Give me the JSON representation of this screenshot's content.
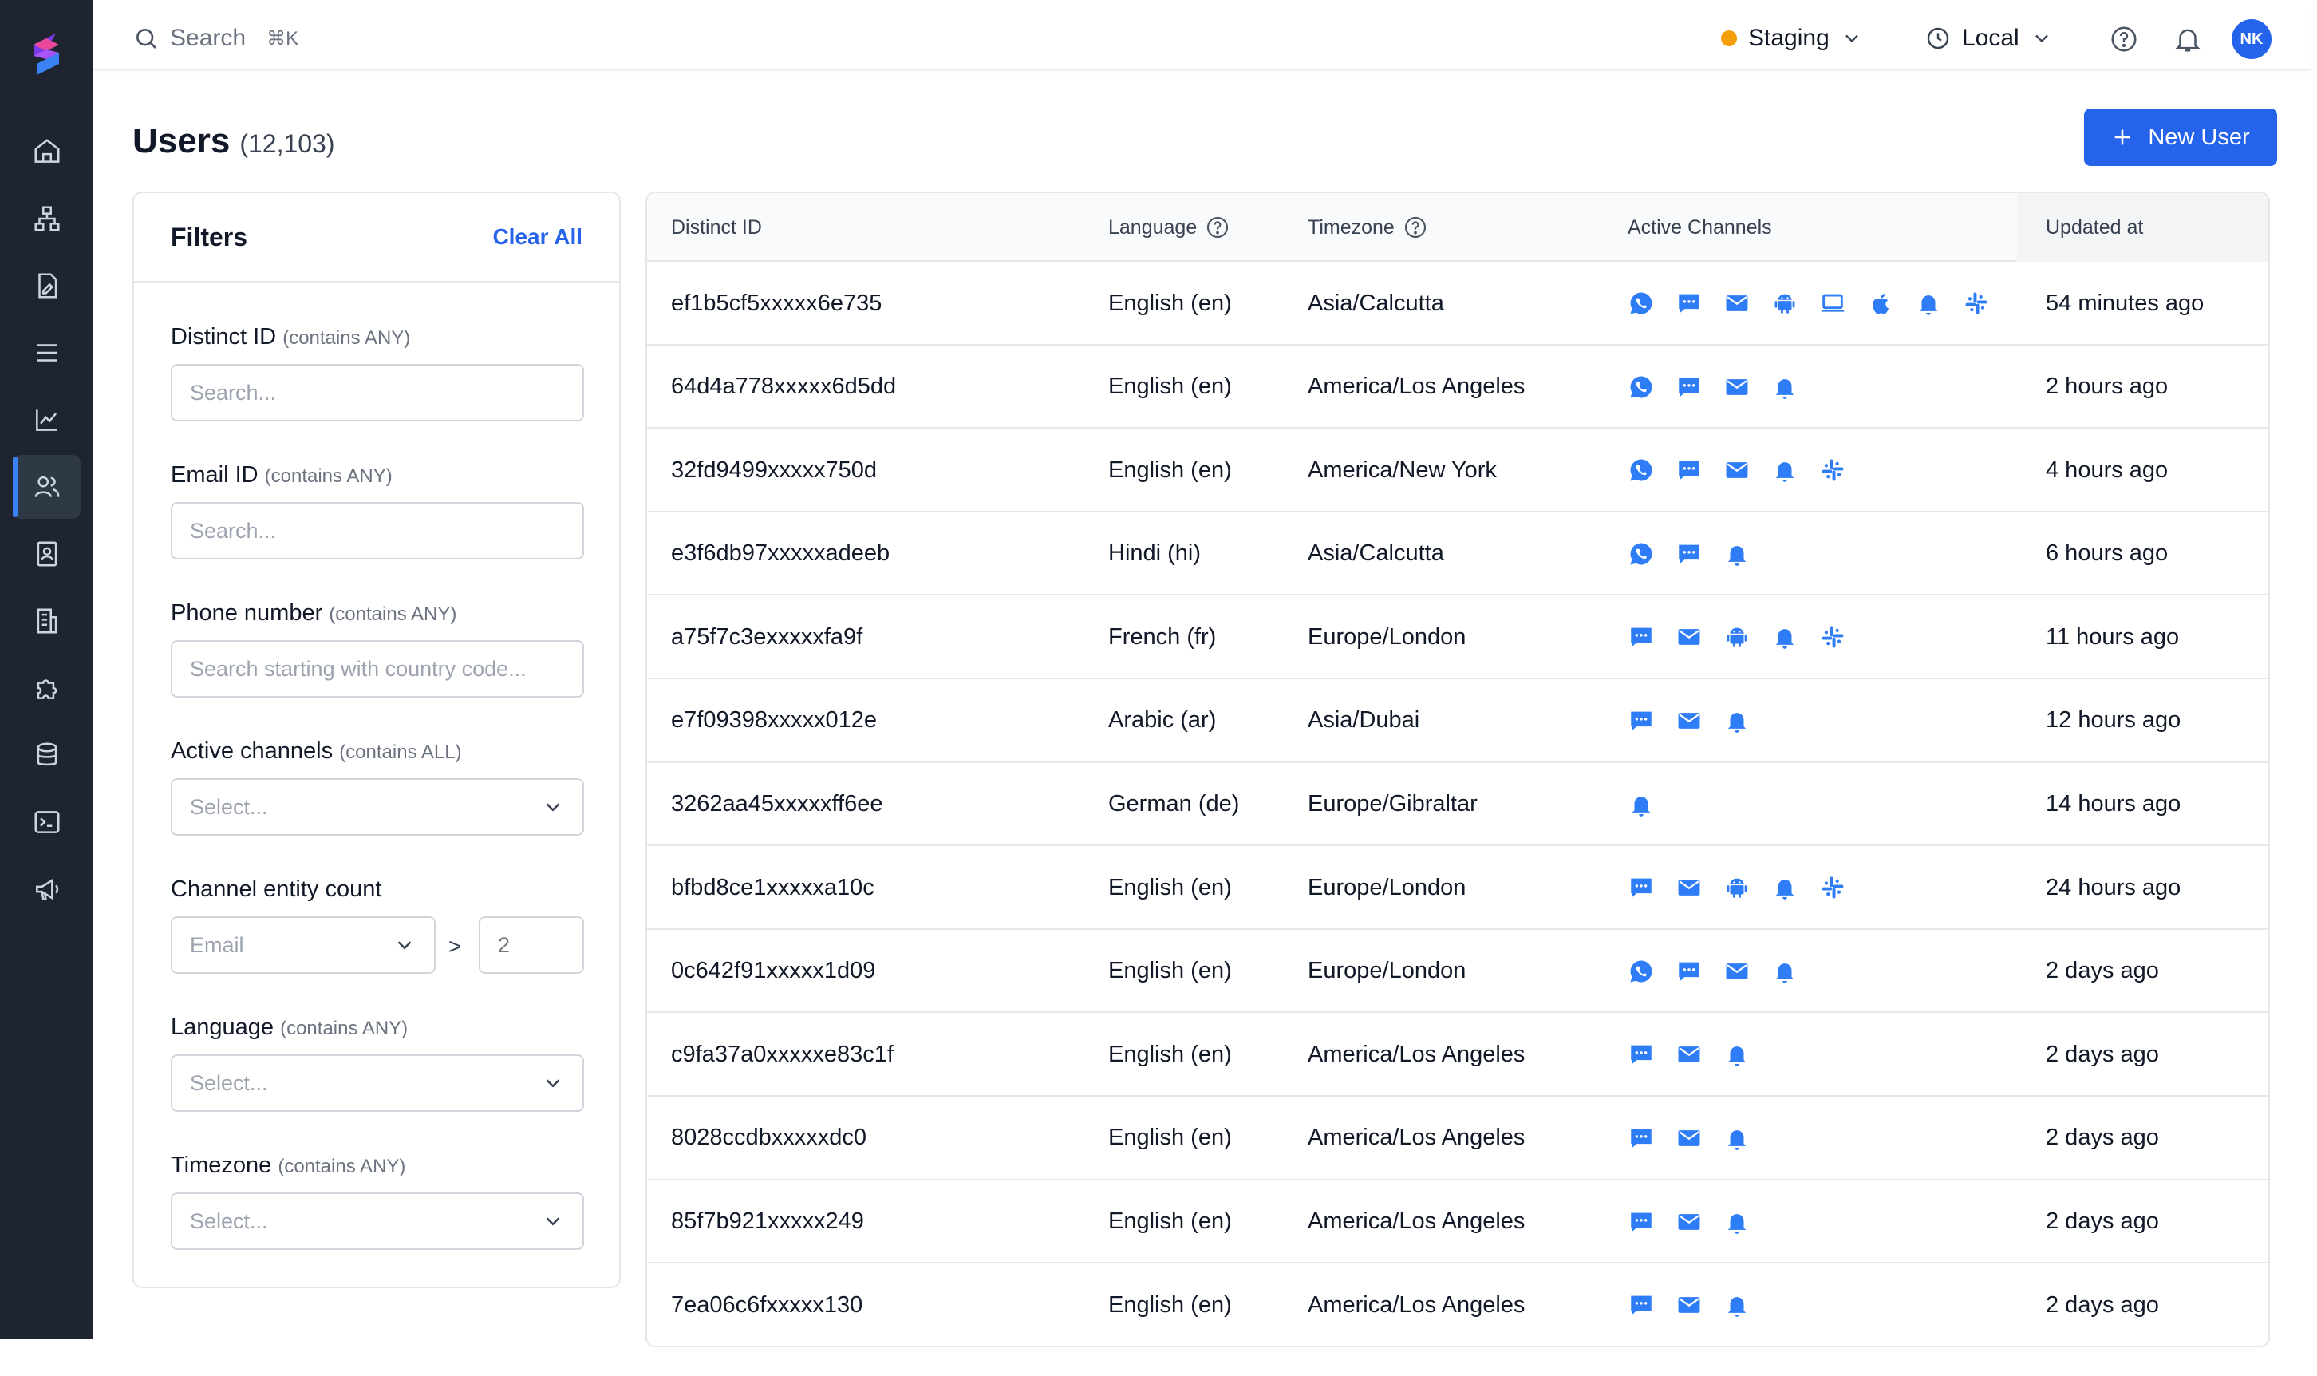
{
  "search": {
    "label": "Search",
    "shortcut": "⌘K"
  },
  "environment": {
    "label": "Staging",
    "color": "#f59e0b"
  },
  "timezone_selector": {
    "label": "Local"
  },
  "user": {
    "initials": "NK"
  },
  "page": {
    "title": "Users",
    "count": "(12,103)",
    "new_user_label": "New User"
  },
  "filters": {
    "title": "Filters",
    "clear_all": "Clear All",
    "distinct_id": {
      "label": "Distinct ID",
      "hint": "(contains ANY)",
      "placeholder": "Search..."
    },
    "email_id": {
      "label": "Email ID",
      "hint": "(contains ANY)",
      "placeholder": "Search..."
    },
    "phone": {
      "label": "Phone number",
      "hint": "(contains ANY)",
      "placeholder": "Search starting with country code..."
    },
    "active_channels": {
      "label": "Active channels",
      "hint": "(contains ALL)",
      "placeholder": "Select..."
    },
    "entity_count": {
      "label": "Channel entity count",
      "channel": "Email",
      "operator": ">",
      "value_placeholder": "2"
    },
    "language": {
      "label": "Language",
      "hint": "(contains ANY)",
      "placeholder": "Select..."
    },
    "timezone": {
      "label": "Timezone",
      "hint": "(contains ANY)",
      "placeholder": "Select..."
    }
  },
  "table": {
    "headers": {
      "distinct_id": "Distinct ID",
      "language": "Language",
      "timezone": "Timezone",
      "channels": "Active Channels",
      "updated": "Updated at"
    },
    "rows": [
      {
        "id": "ef1b5cf5xxxxx6e735",
        "language": "English (en)",
        "timezone": "Asia/Calcutta",
        "channels": [
          "whatsapp",
          "sms",
          "email",
          "android",
          "web",
          "ios",
          "inbox",
          "slack"
        ],
        "updated": "54 minutes ago"
      },
      {
        "id": "64d4a778xxxxx6d5dd",
        "language": "English (en)",
        "timezone": "America/Los Angeles",
        "channels": [
          "whatsapp",
          "sms",
          "email",
          "inbox"
        ],
        "updated": "2 hours ago"
      },
      {
        "id": "32fd9499xxxxx750d",
        "language": "English (en)",
        "timezone": "America/New York",
        "channels": [
          "whatsapp",
          "sms",
          "email",
          "inbox",
          "slack"
        ],
        "updated": "4 hours ago"
      },
      {
        "id": "e3f6db97xxxxxadeeb",
        "language": "Hindi (hi)",
        "timezone": "Asia/Calcutta",
        "channels": [
          "whatsapp",
          "sms",
          "inbox"
        ],
        "updated": "6 hours ago"
      },
      {
        "id": "a75f7c3exxxxxfa9f",
        "language": "French (fr)",
        "timezone": "Europe/London",
        "channels": [
          "sms",
          "email",
          "android",
          "inbox",
          "slack"
        ],
        "updated": "11 hours ago"
      },
      {
        "id": "e7f09398xxxxx012e",
        "language": "Arabic (ar)",
        "timezone": "Asia/Dubai",
        "channels": [
          "sms",
          "email",
          "inbox"
        ],
        "updated": "12 hours ago"
      },
      {
        "id": "3262aa45xxxxxff6ee",
        "language": "German (de)",
        "timezone": "Europe/Gibraltar",
        "channels": [
          "inbox"
        ],
        "updated": "14 hours ago"
      },
      {
        "id": "bfbd8ce1xxxxxa10c",
        "language": "English (en)",
        "timezone": "Europe/London",
        "channels": [
          "sms",
          "email",
          "android",
          "inbox",
          "slack"
        ],
        "updated": "24 hours ago"
      },
      {
        "id": "0c642f91xxxxx1d09",
        "language": "English (en)",
        "timezone": "Europe/London",
        "channels": [
          "whatsapp",
          "sms",
          "email",
          "inbox"
        ],
        "updated": "2 days ago"
      },
      {
        "id": "c9fa37a0xxxxxe83c1f",
        "language": "English (en)",
        "timezone": "America/Los Angeles",
        "channels": [
          "sms",
          "email",
          "inbox"
        ],
        "updated": "2 days ago"
      },
      {
        "id": "8028ccdbxxxxxdc0",
        "language": "English (en)",
        "timezone": "America/Los Angeles",
        "channels": [
          "sms",
          "email",
          "inbox"
        ],
        "updated": "2 days ago"
      },
      {
        "id": "85f7b921xxxxx249",
        "language": "English (en)",
        "timezone": "America/Los Angeles",
        "channels": [
          "sms",
          "email",
          "inbox"
        ],
        "updated": "2 days ago"
      },
      {
        "id": "7ea06c6fxxxxx130",
        "language": "English (en)",
        "timezone": "America/Los Angeles",
        "channels": [
          "sms",
          "email",
          "inbox"
        ],
        "updated": "2 days ago"
      }
    ]
  },
  "colors": {
    "accent": "#2563eb",
    "sidebar": "#1e2530",
    "channel_icon": "#2e7cf6"
  }
}
